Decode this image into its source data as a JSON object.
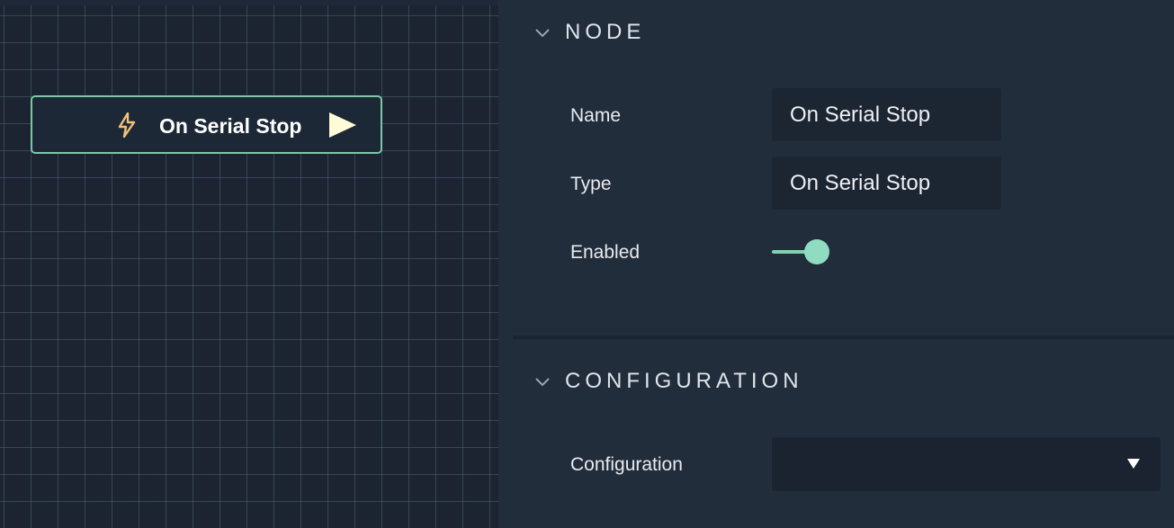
{
  "canvas": {
    "node": {
      "title": "On Serial Stop",
      "icon": "lightning-bolt-icon",
      "port_icon": "play-triangle-icon",
      "accent": "#7fc6a4",
      "bolt_color": "#f2c079"
    }
  },
  "inspector": {
    "node_section": {
      "title": "NODE",
      "name_label": "Name",
      "name_value": "On Serial Stop",
      "type_label": "Type",
      "type_value": "On Serial Stop",
      "enabled_label": "Enabled",
      "enabled": true,
      "toggle_color": "#8fdcc0"
    },
    "configuration_section": {
      "title": "CONFIGURATION",
      "configuration_label": "Configuration",
      "configuration_value": ""
    }
  }
}
